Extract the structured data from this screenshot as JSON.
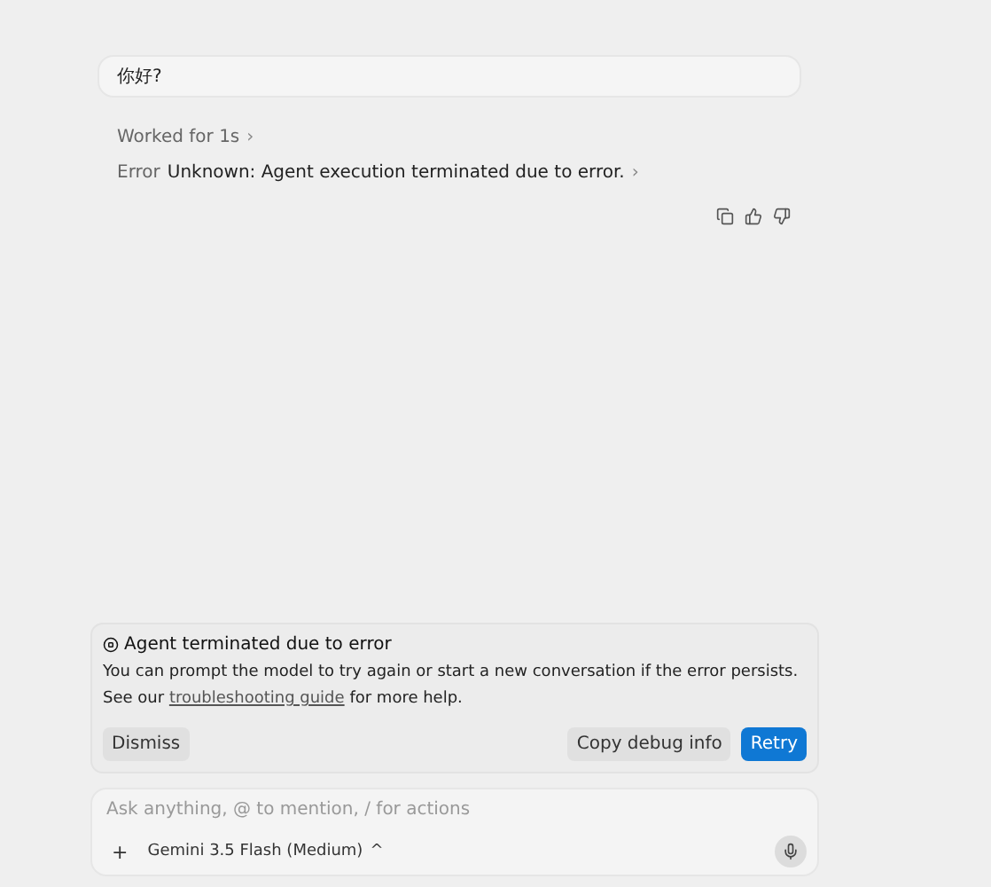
{
  "user_message": "你好?",
  "worked": {
    "label": "Worked for 1s",
    "chevron": "›"
  },
  "error_line": {
    "label": "Error",
    "message": "Unknown: Agent execution terminated due to error.",
    "chevron": "›"
  },
  "error_card": {
    "title": "Agent terminated due to error",
    "body": "You can prompt the model to try again or start a new conversation if the error persists.",
    "help_prefix": "See our",
    "help_link": "troubleshooting guide",
    "help_suffix": "for more help.",
    "buttons": [
      {
        "label": "Dismiss",
        "kind": "secondary"
      },
      {
        "label": "Copy debug info",
        "kind": "secondary"
      },
      {
        "label": "Retry",
        "kind": "primary"
      }
    ]
  },
  "composer": {
    "placeholder": "Ask anything, @ to mention, / for actions",
    "add": "+",
    "model": "Gemini 3.5 Flash (Medium)",
    "model_caret": "^"
  }
}
